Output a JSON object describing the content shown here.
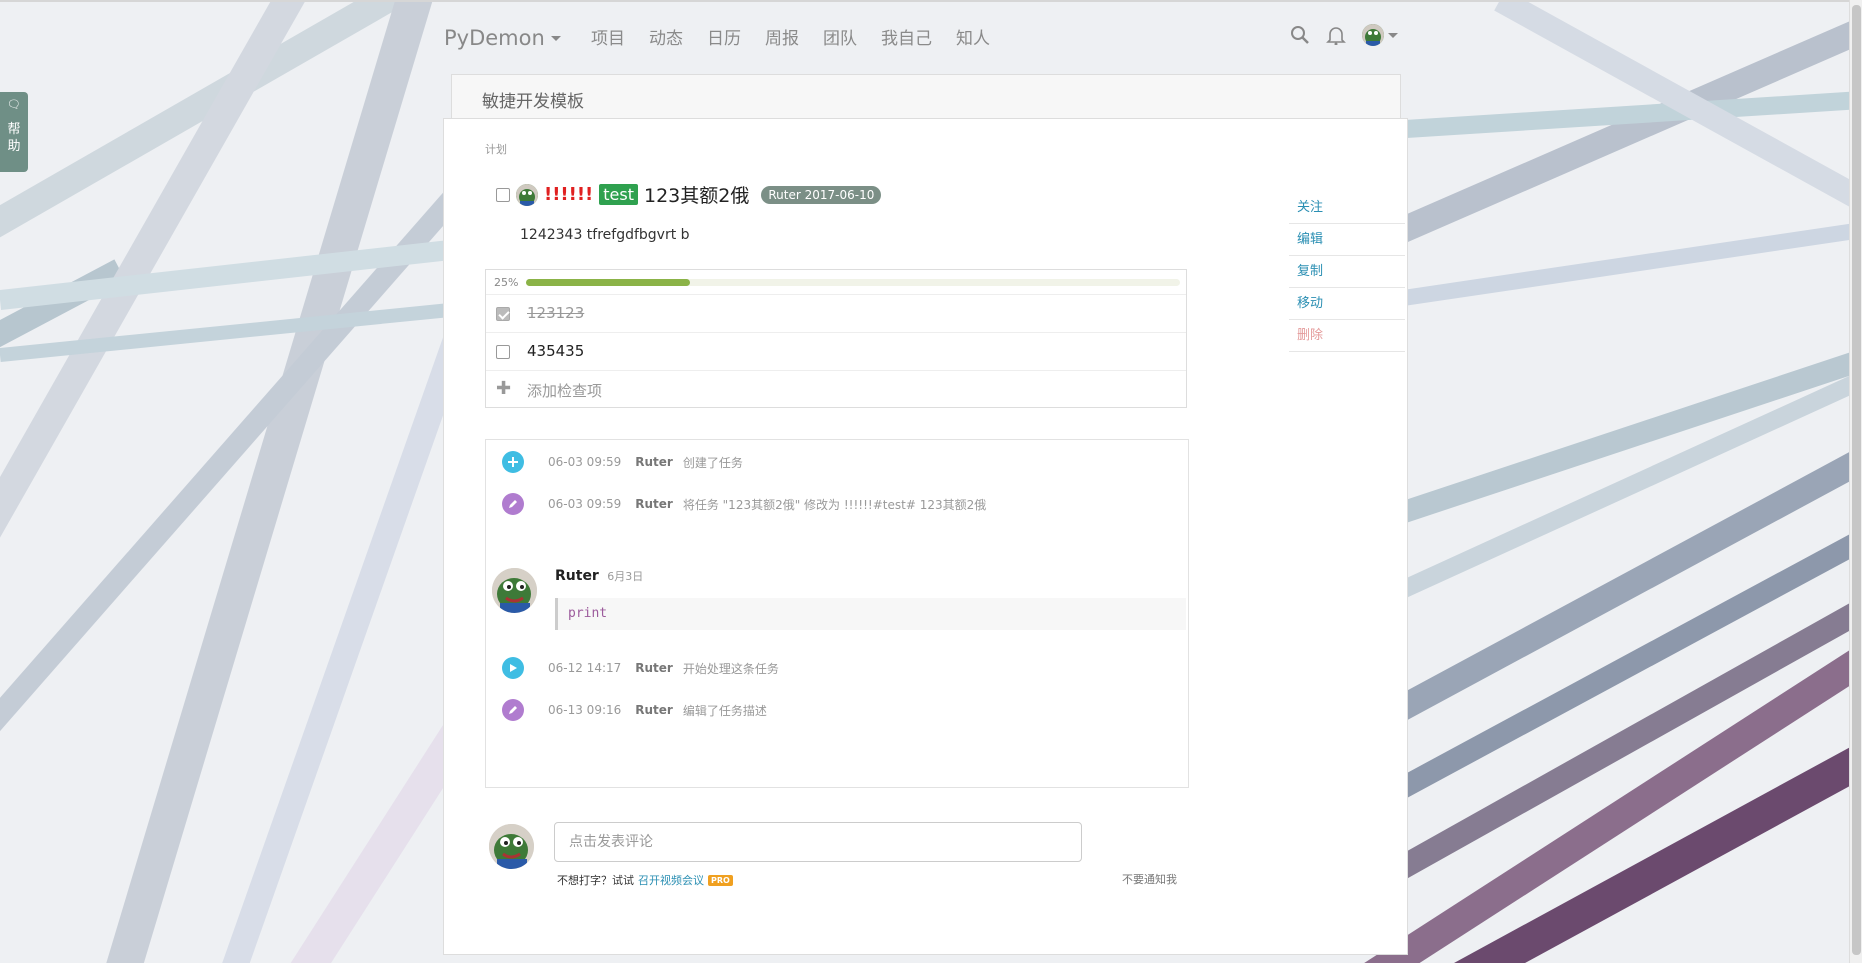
{
  "nav": {
    "brand": "PyDemon",
    "items": [
      "项目",
      "动态",
      "日历",
      "周报",
      "团队",
      "我自己",
      "知人"
    ]
  },
  "help_tab": {
    "label_1": "帮",
    "label_2": "助"
  },
  "project": {
    "name": "敏捷开发模板"
  },
  "breadcrumb": "计划",
  "task": {
    "priority": "!!!!!!",
    "tag": "test",
    "title": "123其额2俄",
    "due_badge": "Ruter 2017-06-10",
    "description": "1242343 tfrefgdfbgvrt b"
  },
  "checklist": {
    "progress_label": "25%",
    "progress_fraction": 0.25,
    "items": [
      {
        "text": "123123",
        "done": true
      },
      {
        "text": "435435",
        "done": false
      }
    ],
    "add_label": "添加检查项"
  },
  "activity": [
    {
      "time": "06-03 09:59",
      "user": "Ruter",
      "text": "创建了任务",
      "icon": "plus-icon",
      "color": "#3fbde3"
    },
    {
      "time": "06-03 09:59",
      "user": "Ruter",
      "text": "将任务 \"123其额2俄\" 修改为 !!!!!!#test# 123其额2俄",
      "icon": "pencil-icon",
      "color": "#b07ccf"
    },
    {
      "time": "06-12 14:17",
      "user": "Ruter",
      "text": "开始处理这条任务",
      "icon": "play-icon",
      "color": "#3fbde3"
    },
    {
      "time": "06-13 09:16",
      "user": "Ruter",
      "text": "编辑了任务描述",
      "icon": "pencil-icon",
      "color": "#b07ccf"
    }
  ],
  "comment": {
    "user": "Ruter",
    "date": "6月3日",
    "code": "print"
  },
  "side_actions": {
    "follow": "关注",
    "edit": "编辑",
    "copy": "复制",
    "move": "移动",
    "delete": "删除"
  },
  "composer": {
    "placeholder": "点击发表评论",
    "hint_prefix": "不想打字？试试",
    "video_link": "召开视频会议",
    "pro_badge": "PRO",
    "no_notify": "不要通知我"
  },
  "colors": {
    "accent_link": "#2b8fb3",
    "tag_green": "#2fa14f",
    "progress_green": "#8bb347",
    "danger": "#e02020"
  }
}
